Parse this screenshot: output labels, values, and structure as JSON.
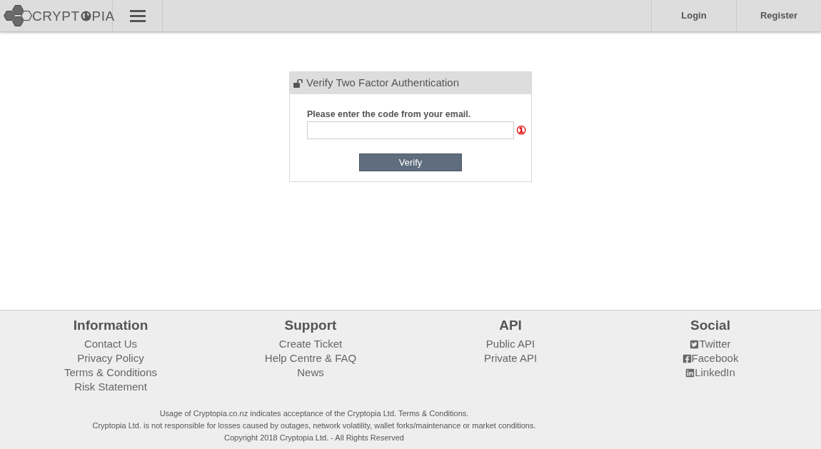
{
  "header": {
    "logo": {
      "text_start": "CRYPT",
      "text_end": "PIA"
    },
    "nav": [
      {
        "label": "Login"
      },
      {
        "label": "Register"
      }
    ]
  },
  "panel": {
    "title": "Verify Two Factor Authentication",
    "field_label": "Please enter the code from your email.",
    "marker": "①",
    "button": "Verify"
  },
  "footer": {
    "columns": [
      {
        "heading": "Information",
        "links": [
          {
            "label": "Contact Us"
          },
          {
            "label": "Privacy Policy"
          },
          {
            "label": "Terms & Conditions"
          },
          {
            "label": "Risk Statement"
          }
        ]
      },
      {
        "heading": "Support",
        "links": [
          {
            "label": "Create Ticket"
          },
          {
            "label": "Help Centre & FAQ"
          },
          {
            "label": "News"
          }
        ]
      },
      {
        "heading": "API",
        "links": [
          {
            "label": "Public API"
          },
          {
            "label": "Private API"
          }
        ]
      },
      {
        "heading": "Social",
        "links": [
          {
            "label": "Twitter",
            "kind": "twitter"
          },
          {
            "label": "Facebook",
            "kind": "facebook"
          },
          {
            "label": "LinkedIn",
            "kind": "linkedin"
          }
        ]
      }
    ],
    "legal": [
      "Usage of Cryptopia.co.nz indicates acceptance of the Cryptopia Ltd. Terms & Conditions.",
      "Cryptopia Ltd. is not responsible for losses caused by outages, network volatility, wallet forks/maintenance or market conditions.",
      "Copyright 2018 Cryptopia Ltd. - All Rights Reserved"
    ]
  }
}
